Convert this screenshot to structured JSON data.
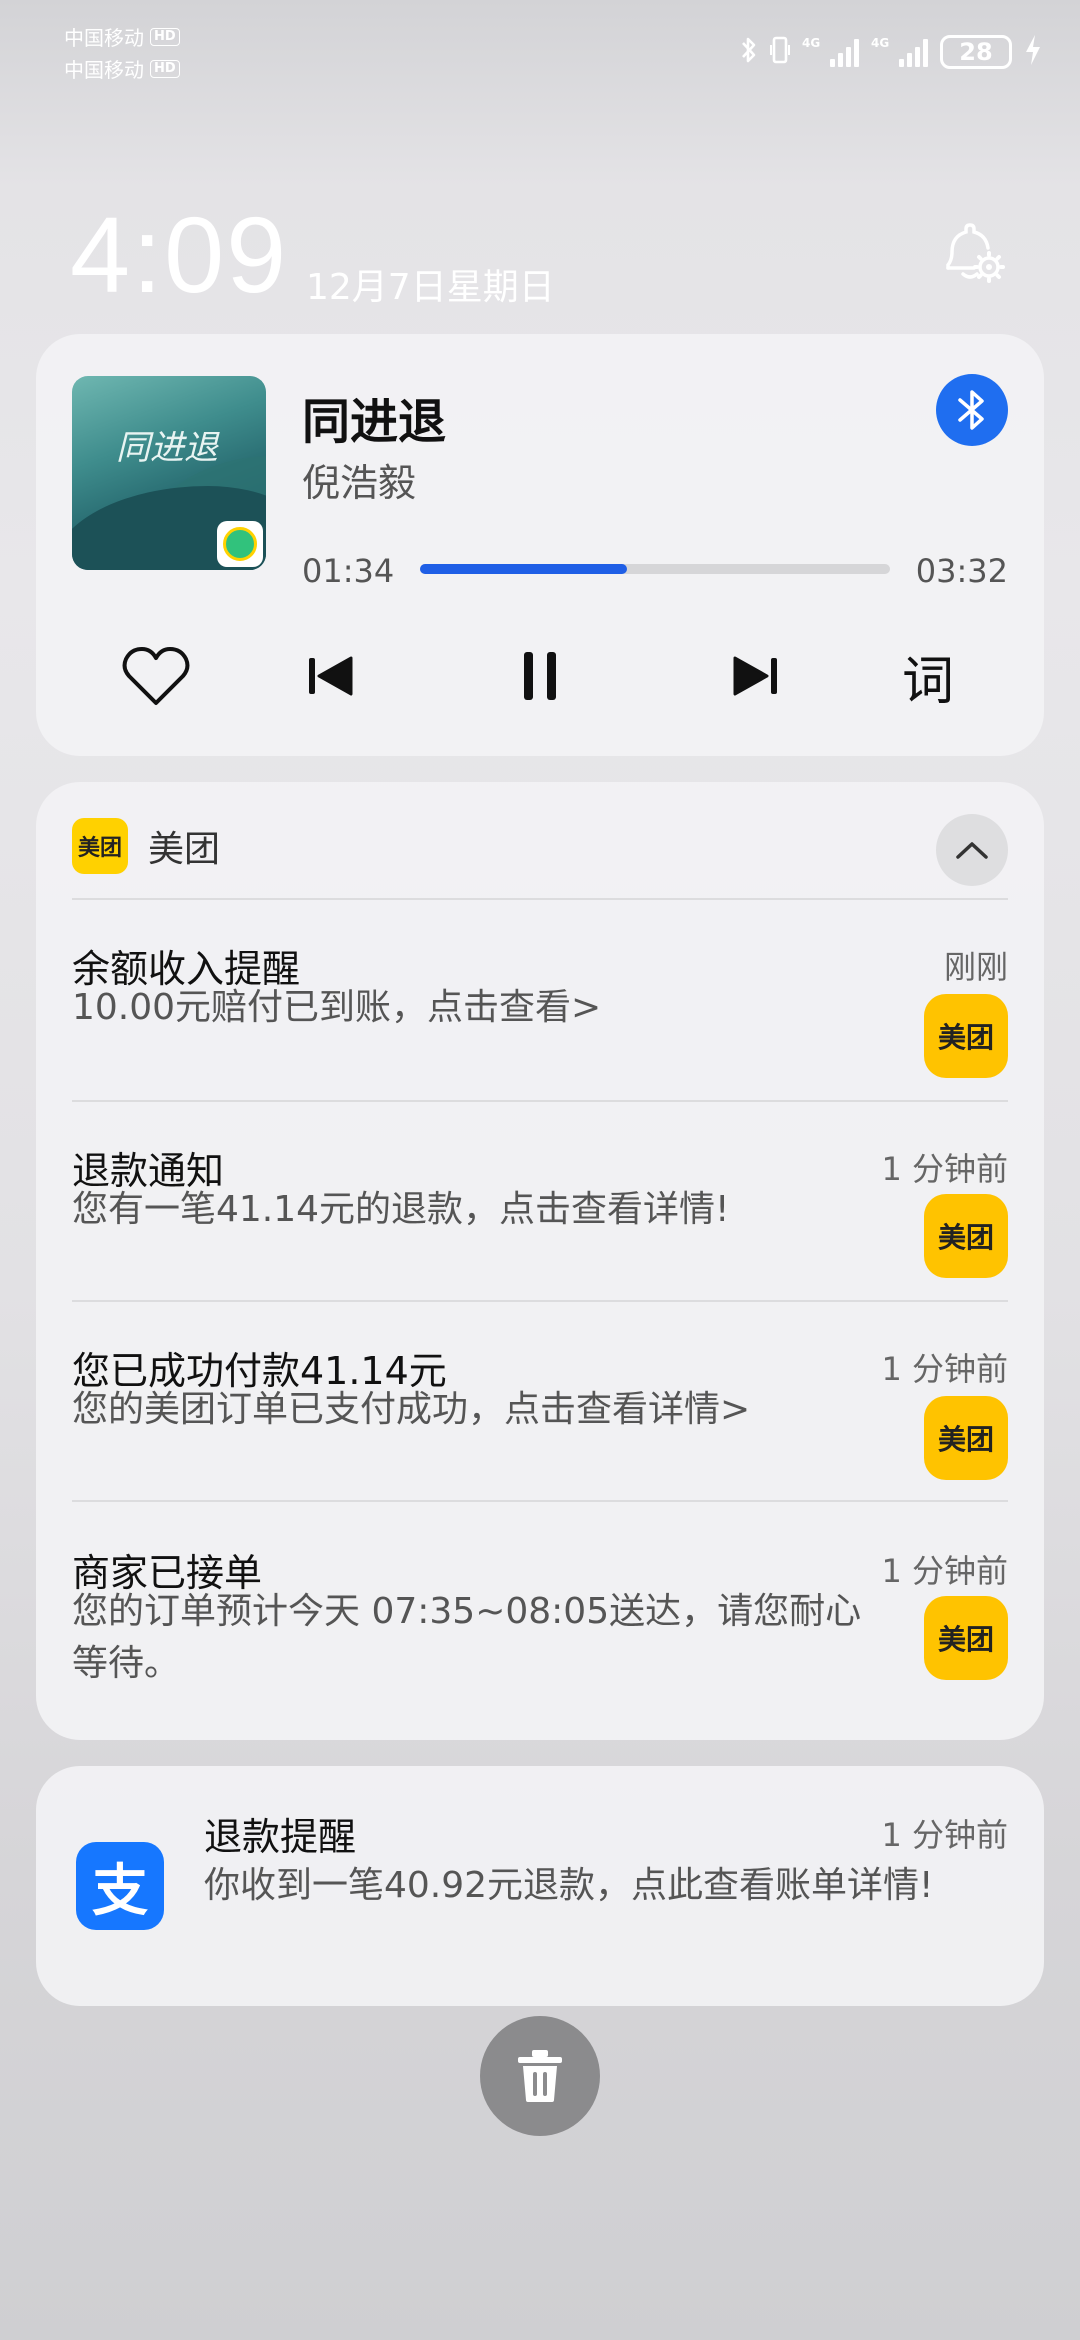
{
  "status_bar": {
    "carrier1": "中国移动",
    "carrier2": "中国移动",
    "hd": "HD",
    "network1": "4G",
    "network2": "4G",
    "battery": "28"
  },
  "lockscreen": {
    "time": "4:09",
    "date": "12月7日星期日"
  },
  "music": {
    "cover_text": "同进退",
    "title": "同进退",
    "artist": "倪浩毅",
    "elapsed": "01:34",
    "duration": "03:32",
    "progress": 0.44,
    "lyrics_label": "词"
  },
  "meituan": {
    "app_name": "美团",
    "logo_text": "美团",
    "notifications": [
      {
        "title": "余额收入提醒",
        "time": "刚刚",
        "body": "10.00元赔付已到账，点击查看>",
        "icon_text": "美团"
      },
      {
        "title": "退款通知",
        "time": "1 分钟前",
        "body": "您有一笔41.14元的退款，点击查看详情!",
        "icon_text": "美团"
      },
      {
        "title": "您已成功付款41.14元",
        "time": "1 分钟前",
        "body": "您的美团订单已支付成功，点击查看详情>",
        "icon_text": "美团"
      },
      {
        "title": "商家已接单",
        "time": "1 分钟前",
        "body": "您的订单预计今天 07:35~08:05送达，请您耐心等待。",
        "icon_text": "美团"
      }
    ]
  },
  "alipay": {
    "logo_text": "支",
    "title": "退款提醒",
    "time": "1 分钟前",
    "body": "你收到一笔40.92元退款，点此查看账单详情!"
  },
  "colors": {
    "accent_blue": "#1f5fe6",
    "meituan_yellow": "#ffc300",
    "alipay_blue": "#1677ff"
  }
}
